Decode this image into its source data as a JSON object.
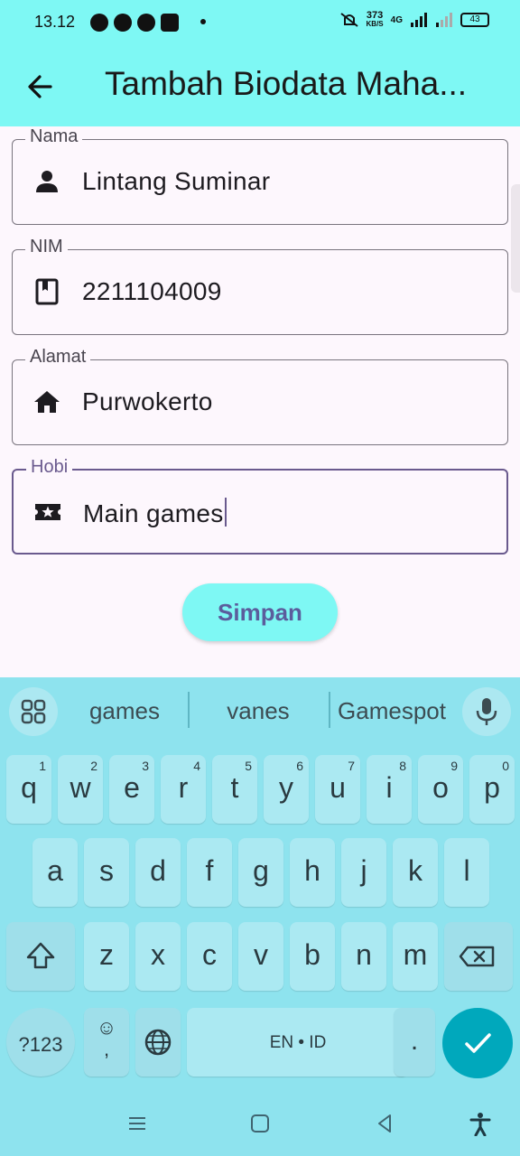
{
  "status_bar": {
    "time": "13.12",
    "net_speed_value": "373",
    "net_speed_unit": "KB/S",
    "network": "4G",
    "battery": "43"
  },
  "app_bar": {
    "back_icon": "arrow-back-icon",
    "title": "Tambah Biodata Maha..."
  },
  "form": {
    "fields": [
      {
        "label": "Nama",
        "value": "Lintang Suminar",
        "icon": "person-icon"
      },
      {
        "label": "NIM",
        "value": "2211104009",
        "icon": "book-icon"
      },
      {
        "label": "Alamat",
        "value": "Purwokerto",
        "icon": "home-icon"
      },
      {
        "label": "Hobi",
        "value": "Main games",
        "icon": "ticket-star-icon",
        "focused": true
      }
    ],
    "submit_label": "Simpan"
  },
  "colors": {
    "app_bar": "#7ef8f4",
    "background": "#fdf7fd",
    "focus": "#6a5a8e",
    "keyboard": "#8ee3ee",
    "enter_key": "#00a8bc"
  },
  "keyboard": {
    "suggestions": [
      "games",
      "vanes",
      "Gamespot"
    ],
    "row1": [
      {
        "ch": "q",
        "num": "1"
      },
      {
        "ch": "w",
        "num": "2"
      },
      {
        "ch": "e",
        "num": "3"
      },
      {
        "ch": "r",
        "num": "4"
      },
      {
        "ch": "t",
        "num": "5"
      },
      {
        "ch": "y",
        "num": "6"
      },
      {
        "ch": "u",
        "num": "7"
      },
      {
        "ch": "i",
        "num": "8"
      },
      {
        "ch": "o",
        "num": "9"
      },
      {
        "ch": "p",
        "num": "0"
      }
    ],
    "row2": [
      "a",
      "s",
      "d",
      "f",
      "g",
      "h",
      "j",
      "k",
      "l"
    ],
    "row3": [
      "z",
      "x",
      "c",
      "v",
      "b",
      "n",
      "m"
    ],
    "symbols_label": "?123",
    "comma_label": ",",
    "space_label": "EN • ID",
    "period_label": "."
  }
}
